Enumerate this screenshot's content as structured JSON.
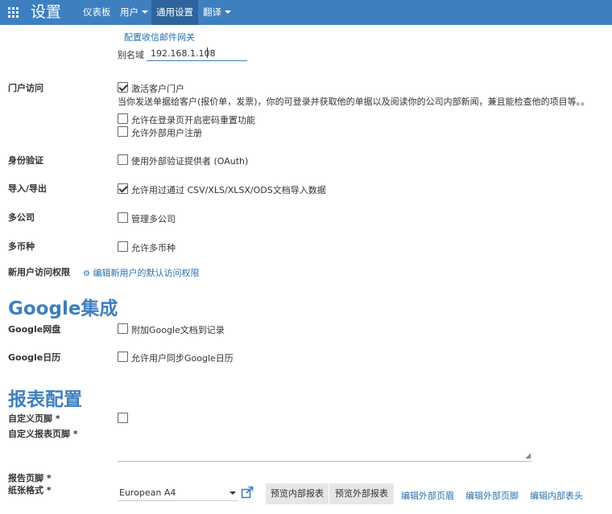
{
  "topbar": {
    "title": "设置",
    "menus": [
      "仪表板",
      "用户",
      "通用设置",
      "翻译"
    ],
    "active_menu": "通用设置"
  },
  "mail": {
    "gateway_link": "配置收信邮件网关",
    "alias_label": "别名域",
    "alias_value": "192.168.1.108"
  },
  "portal": {
    "label": "门户访问",
    "enable_label": "激活客户门户",
    "enable_checked": true,
    "description": "当你发送单据给客户(报价单，发票)，你的可登录并获取他的单据以及阅读你的公司内部新闻，兼且能检查他的项目等。。",
    "password_reset_label": "允许在登录页开启密码重置功能",
    "password_reset_checked": false,
    "signup_label": "允许外部用户注册",
    "signup_checked": false
  },
  "auth": {
    "label": "身份验证",
    "oauth_label": "使用外部验证提供者 (OAuth)",
    "checked": false
  },
  "import": {
    "label": "导入/导出",
    "option_label": "允许用过通过 CSV/XLS/XLSX/ODS文档导入数据",
    "checked": true
  },
  "multicompany": {
    "label": "多公司",
    "option_label": "管理多公司",
    "checked": false
  },
  "multicurrency": {
    "label": "多币种",
    "option_label": "允许多币种",
    "checked": false
  },
  "access": {
    "label": "新用户访问权限",
    "link": "编辑新用户的默认访问权限"
  },
  "google": {
    "heading": "Google集成",
    "drive_label": "Google网盘",
    "drive_option": "附加Google文档到记录",
    "drive_checked": false,
    "calendar_label": "Google日历",
    "calendar_option": "允许用户同步Google日历",
    "calendar_checked": false
  },
  "report": {
    "heading": "报表配置",
    "custom_footer_label": "自定义页脚 *",
    "custom_footer_checked": false,
    "custom_report_footer_label": "自定义报表页脚 *",
    "report_footer_label": "报告页脚 *",
    "paper_format_label": "纸张格式 *",
    "paper_format_value": "European A4",
    "preview_internal": "预览内部报表",
    "preview_external": "预览外部报表",
    "edit_external_header": "编辑外部页眉",
    "edit_external_footer": "编辑外部页脚",
    "edit_internal_header": "编辑内部表头"
  }
}
